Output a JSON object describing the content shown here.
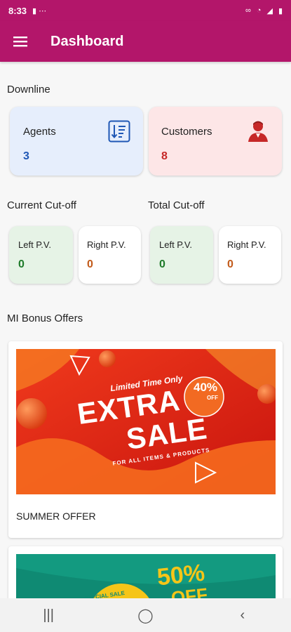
{
  "status": {
    "time": "8:33",
    "icons": [
      "notification-icon",
      "link-icon",
      "wifi-icon",
      "signal-icon",
      "battery-icon"
    ]
  },
  "appbar": {
    "title": "Dashboard"
  },
  "downline": {
    "section_label": "Downline",
    "agents": {
      "label": "Agents",
      "count": "3"
    },
    "customers": {
      "label": "Customers",
      "count": "8"
    }
  },
  "current_cutoff": {
    "section_label": "Current Cut-off",
    "left_label": "Left P.V.",
    "left_value": "0",
    "right_label": "Right P.V.",
    "right_value": "0"
  },
  "total_cutoff": {
    "section_label": "Total Cut-off",
    "left_label": "Left P.V.",
    "left_value": "0",
    "right_label": "Right P.V.",
    "right_value": "0"
  },
  "bonus": {
    "section_label": "MI Bonus Offers",
    "offers": [
      {
        "banner_top": "Limited Time Only",
        "banner_line1": "EXTRA",
        "banner_line2": "SALE",
        "banner_badge": "40%",
        "banner_badge_sub": "OFF",
        "banner_tagline": "FOR ALL ITEMS & PRODUCTS",
        "caption": "SUMMER OFFER"
      },
      {
        "banner_badge": "50%",
        "banner_badge_sub": "OFF",
        "banner_left": "SPECIAL SALE"
      }
    ]
  },
  "colors": {
    "brand": "#b3166a",
    "agents_bg": "#e6eefc",
    "customers_bg": "#fde6e7",
    "pv_left_bg": "#e6f3e6",
    "green": "#1e7a2a",
    "orange": "#c25a1a",
    "blue": "#1f57b5",
    "red": "#c62828"
  }
}
